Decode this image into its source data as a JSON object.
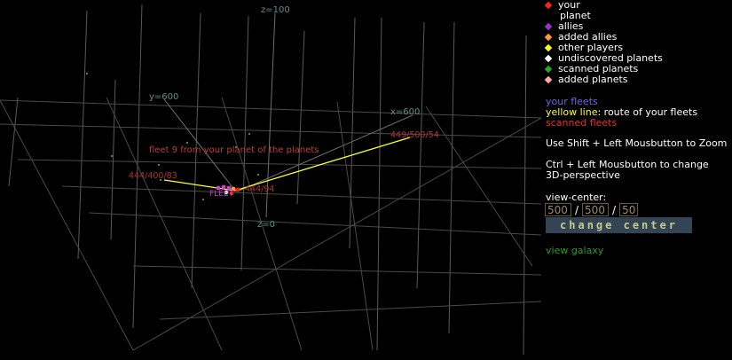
{
  "space_view": {
    "axis_labels": {
      "z_top": "z=100",
      "y_axis": "y=600",
      "x_axis": "x=600",
      "z_zero": "z=0"
    },
    "coordinates": {
      "left": "444/400/83",
      "right": "449/500/54",
      "near": "444/94"
    },
    "fleet_label": "fleet 9 from your planet of the planets",
    "planet_tag": "FLEET"
  },
  "legend": {
    "items": [
      {
        "label": "your",
        "label2": "planet",
        "color": "#ff2020"
      },
      {
        "label": "allies",
        "color": "#9933cc"
      },
      {
        "label": "added allies",
        "color": "#ff9933"
      },
      {
        "label": "other players",
        "color": "#ffff00"
      },
      {
        "label": "undiscovered planets",
        "color": "#ffffff"
      },
      {
        "label": "scanned planets",
        "color": "#22aa22"
      },
      {
        "label": "added planets",
        "color": "#ffaaaa"
      }
    ]
  },
  "info": {
    "your_fleets": "your fleets",
    "yellow_line_label": "yellow line",
    "yellow_line_text": ": route of your fleets",
    "scanned_fleets": "scanned fleets",
    "zoom_hint": "Use Shift + Left Mousbutton to Zoom",
    "ctrl_hint_1": "Ctrl + Left Mousbutton to change",
    "ctrl_hint_2": "3D-perspective"
  },
  "view_center": {
    "label": "view-center:",
    "x": "500",
    "y": "500",
    "z": "50",
    "separator": "/",
    "button_label": "change center"
  },
  "view_galaxy_label": "view galaxy"
}
